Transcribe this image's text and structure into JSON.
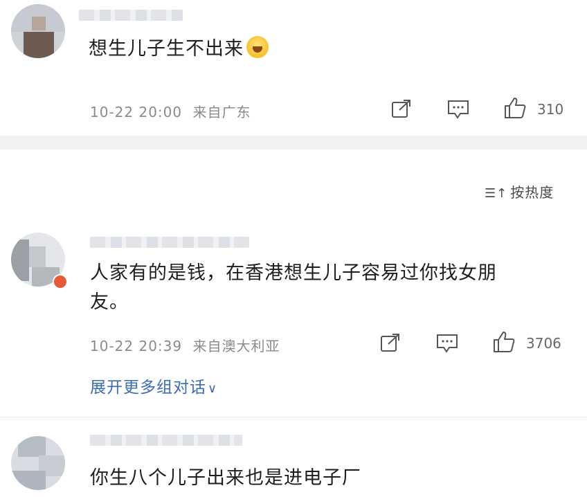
{
  "comments": [
    {
      "text": "想生儿子生不出来",
      "emoji": "laughing-crying-emoji",
      "time": "10-22 20:00",
      "location": "来自广东",
      "likes": "310"
    },
    {
      "text_line1": "人家有的是钱，在香港想生儿子容易过你找女朋",
      "text_line2": "友。",
      "time": "10-22 20:39",
      "location": "来自澳大利亚",
      "likes": "3706",
      "expand_label": "展开更多组对话",
      "expand_icon": "chevron-down-icon"
    },
    {
      "text": "你生八个儿子出来也是进电子厂"
    }
  ],
  "sort": {
    "label": "按热度",
    "icon": "sort-icon"
  },
  "colors": {
    "link": "#3a6bb5",
    "meta": "#8a8a8a",
    "divider": "#f2f2f2"
  }
}
